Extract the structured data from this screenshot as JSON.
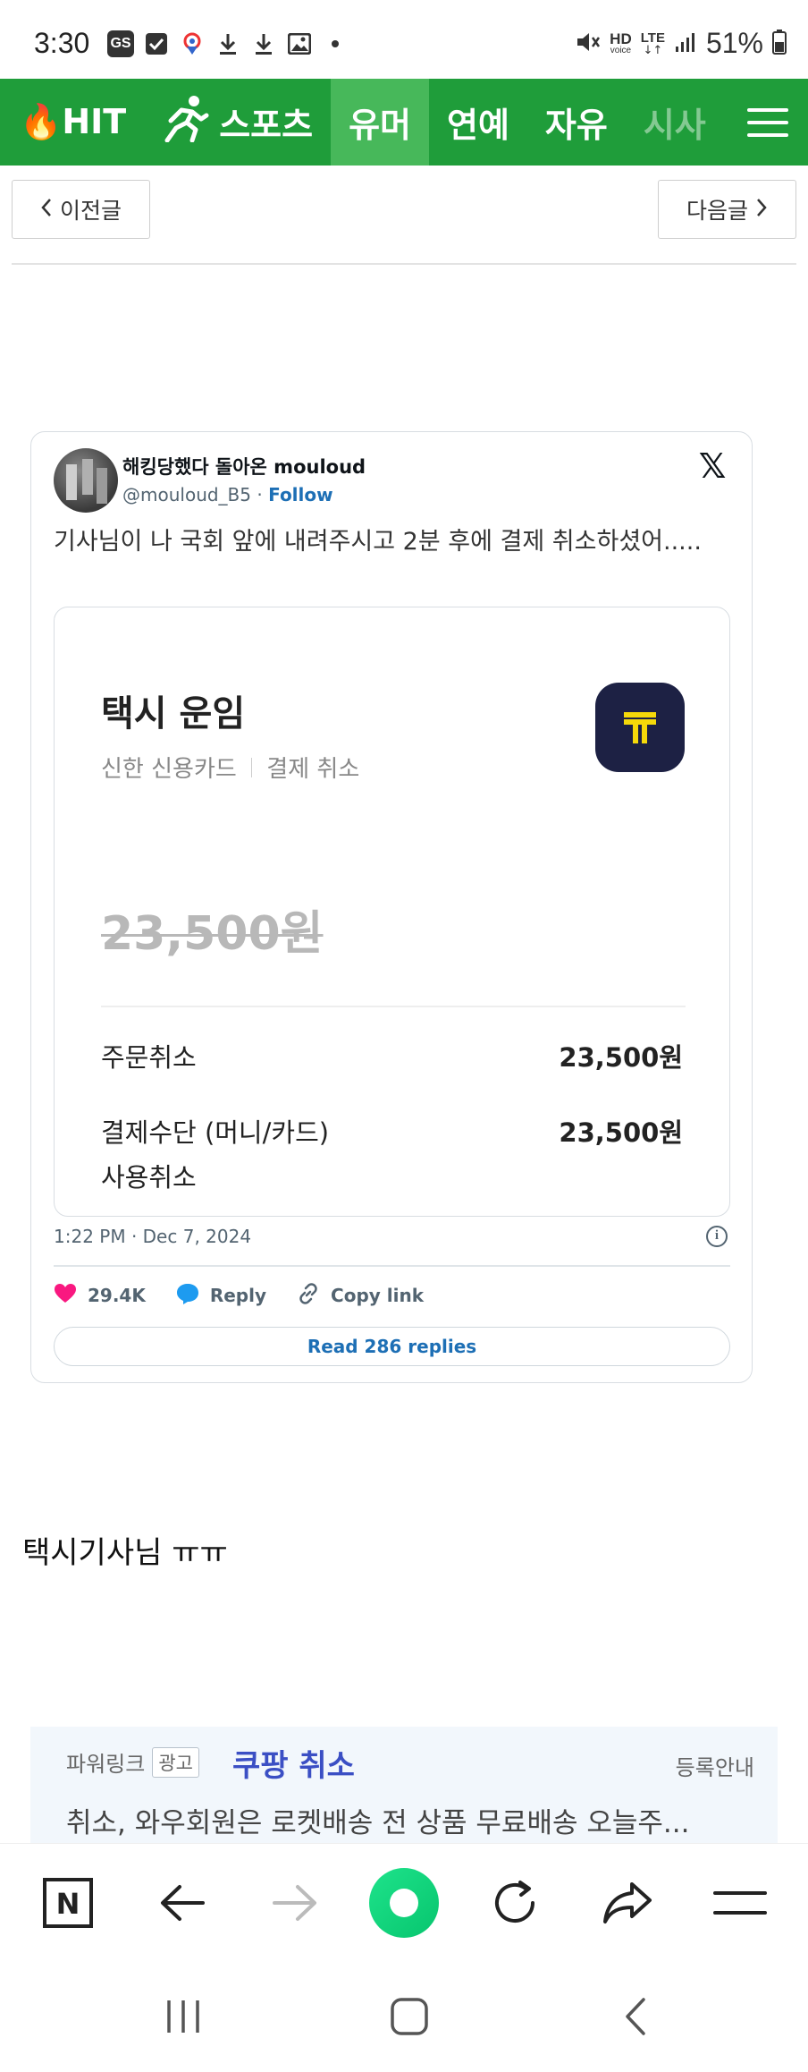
{
  "status_bar": {
    "time": "3:30",
    "left_icons": [
      "gs-icon",
      "check-icon",
      "location-icon",
      "download-icon",
      "download-icon",
      "image-icon",
      "dot-icon"
    ],
    "gs_label": "GS",
    "network_hd": "HD",
    "network_hd_sub": "voice",
    "network_lte": "LTE",
    "battery_percent": "51%"
  },
  "nav": {
    "tabs": [
      {
        "label": "🔥HIT",
        "active": false
      },
      {
        "label": "스포츠",
        "active": false
      },
      {
        "label": "유머",
        "active": true
      },
      {
        "label": "연예",
        "active": false
      },
      {
        "label": "자유",
        "active": false
      },
      {
        "label": "시사",
        "active": false
      }
    ],
    "brand_color": "#1f9d3a",
    "active_color": "#47b85a"
  },
  "pager": {
    "prev_label": "이전글",
    "next_label": "다음글"
  },
  "tweet": {
    "author_name": "해킹당했다 돌아온 mouloud",
    "author_handle": "@mouloud_B5",
    "handle_sep": " · ",
    "follow_label": "Follow",
    "text": "기사님이 나 국회 앞에 내려주시고 2분 후에 결제 취소하셨어.....",
    "receipt": {
      "title": "택시 운임",
      "card": "신한 신용카드",
      "status": "결제 취소",
      "amount_struck": "23,500원",
      "rows": [
        {
          "label": "주문취소",
          "value": "23,500원"
        },
        {
          "label": "결제수단 (머니/카드)",
          "label2": "사용취소",
          "value": "23,500원"
        }
      ]
    },
    "date": "1:22 PM · Dec 7, 2024",
    "likes": "29.4K",
    "reply_label": "Reply",
    "copy_link_label": "Copy link",
    "read_replies_label": "Read 286 replies"
  },
  "post_text": "택시기사님 ㅠㅠ",
  "ad": {
    "powerlink": "파워링크",
    "badge": "광고",
    "title": "쿠팡 취소",
    "register": "등록안내",
    "desc": "취소, 와우회원은 로켓배송 전 상품 무료배송 오늘주..."
  },
  "browser_bar": {
    "icons": [
      "naver-icon",
      "back-arrow-icon",
      "forward-arrow-icon",
      "home-icon",
      "refresh-icon",
      "share-icon",
      "menu-icon"
    ],
    "n_label": "N"
  },
  "system_nav": {
    "icons": [
      "recents-icon",
      "home-square-icon",
      "back-icon"
    ]
  }
}
